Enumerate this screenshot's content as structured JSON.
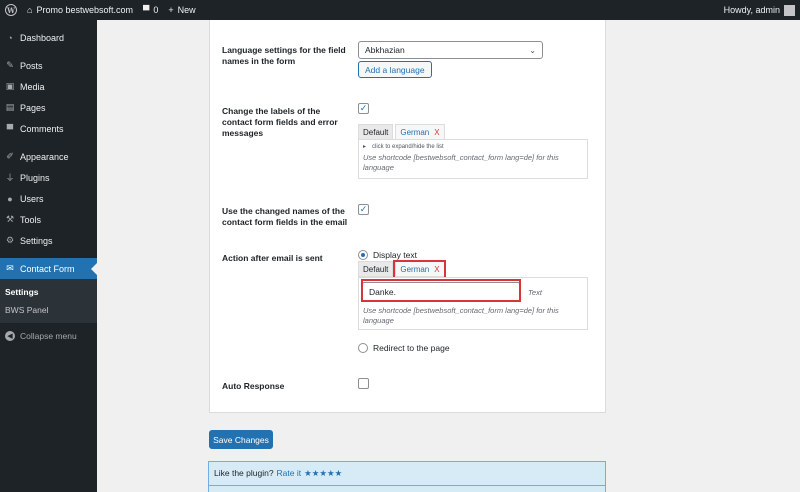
{
  "adminbar": {
    "site_name": "Promo bestwebsoft.com",
    "comments_count": "0",
    "new_label": "New",
    "howdy": "Howdy, admin"
  },
  "sidebar": {
    "items": [
      {
        "label": "Dashboard",
        "icon": "dashboard-icon"
      },
      {
        "label": "Posts",
        "icon": "pin-icon"
      },
      {
        "label": "Media",
        "icon": "media-icon"
      },
      {
        "label": "Pages",
        "icon": "pages-icon"
      },
      {
        "label": "Comments",
        "icon": "comment-icon"
      },
      {
        "label": "Appearance",
        "icon": "brush-icon"
      },
      {
        "label": "Plugins",
        "icon": "plug-icon"
      },
      {
        "label": "Users",
        "icon": "users-icon"
      },
      {
        "label": "Tools",
        "icon": "wrench-icon"
      },
      {
        "label": "Settings",
        "icon": "settings-icon"
      },
      {
        "label": "Contact Form",
        "icon": "mail-icon"
      }
    ],
    "submenu": [
      "Settings",
      "BWS Panel"
    ],
    "collapse_label": "Collapse menu"
  },
  "form": {
    "lang_label": "Language settings for the field names in the form",
    "lang_select_value": "Abkhazian",
    "add_language": "Add a language",
    "change_labels_label": "Change the labels of the contact form fields and error messages",
    "tab_default": "Default",
    "tab_german": "German",
    "tab_close": "X",
    "expand_hint": "click to expand/hide the list",
    "shortcode_note": "Use shortcode [bestwebsoft_contact_form lang=de] for this language",
    "use_changed_label": "Use the changed names of the contact form fields in the email",
    "action_label": "Action after email is sent",
    "display_text": "Display text",
    "text_value": "Danke.",
    "text_hint": "Text",
    "redirect_label": "Redirect to the page",
    "auto_response_label": "Auto Response"
  },
  "save_button": "Save Changes",
  "rate": {
    "prompt": "Like the plugin?",
    "link": "Rate it",
    "stars": "★★★★★"
  },
  "colors": {
    "accent": "#2271b1",
    "highlight": "#d63638",
    "adminbar": "#1d2327"
  }
}
